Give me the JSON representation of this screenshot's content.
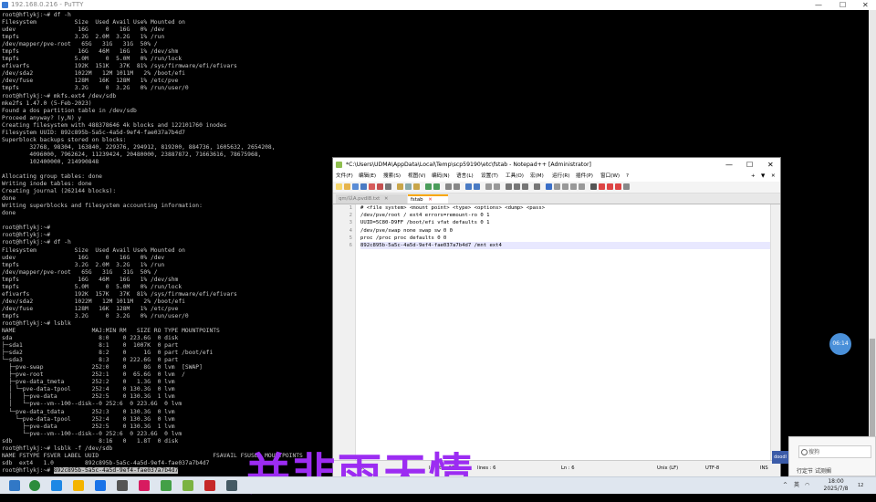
{
  "putty": {
    "title": "192.168.0.216 - PuTTY",
    "controls": {
      "minimize": "—",
      "maximize": "☐",
      "close": "✕"
    },
    "terminal_lines": [
      "root@hflykj:~# df -h",
      "Filesystem           Size  Used Avail Use% Mounted on",
      "udev                  16G     0   16G   0% /dev",
      "tmpfs                3.2G  2.0M  3.2G   1% /run",
      "/dev/mapper/pve-root   65G   31G   31G  50% /",
      "tmpfs                 16G   46M   16G   1% /dev/shm",
      "tmpfs                5.0M     0  5.0M   0% /run/lock",
      "efivarfs             192K  151K   37K  81% /sys/firmware/efi/efivars",
      "/dev/sda2            1022M   12M 1011M   2% /boot/efi",
      "/dev/fuse            128M   16K  128M   1% /etc/pve",
      "tmpfs                3.2G     0  3.2G   0% /run/user/0",
      "root@hflykj:~# mkfs.ext4 /dev/sdb",
      "mke2fs 1.47.0 (5-Feb-2023)",
      "Found a dos partition table in /dev/sdb",
      "Proceed anyway? (y,N) y",
      "Creating filesystem with 488378646 4k blocks and 122101760 inodes",
      "Filesystem UUID: 892c895b-5a5c-4a5d-9ef4-fae037a7b4d7",
      "Superblock backups stored on blocks:",
      "        32768, 98304, 163840, 229376, 294912, 819200, 884736, 1605632, 2654208,",
      "        4096000, 7962624, 11239424, 20480000, 23887872, 71663616, 78675968,",
      "        102400000, 214990848",
      "",
      "Allocating group tables: done",
      "Writing inode tables: done",
      "Creating journal (262144 blocks):",
      "done",
      "Writing superblocks and filesystem accounting information:",
      "done",
      "",
      "root@hflykj:~#",
      "root@hflykj:~#",
      "root@hflykj:~# df -h",
      "Filesystem           Size  Used Avail Use% Mounted on",
      "udev                  16G     0   16G   0% /dev",
      "tmpfs                3.2G  2.0M  3.2G   1% /run",
      "/dev/mapper/pve-root   65G   31G   31G  50% /",
      "tmpfs                 16G   46M   16G   1% /dev/shm",
      "tmpfs                5.0M     0  5.0M   0% /run/lock",
      "efivarfs             192K  157K   37K  81% /sys/firmware/efi/efivars",
      "/dev/sda2            1022M   12M 1011M   2% /boot/efi",
      "/dev/fuse            128M   16K  128M   1% /etc/pve",
      "tmpfs                3.2G     0  3.2G   0% /run/user/0",
      "root@hflykj:~# lsblk",
      "NAME                      MAJ:MIN RM   SIZE RO TYPE MOUNTPOINTS",
      "sda                         8:0    0 223.6G  0 disk",
      "├─sda1                      8:1    0  1007K  0 part",
      "├─sda2                      8:2    0     1G  0 part /boot/efi",
      "└─sda3                      8:3    0 222.6G  0 part",
      "  ├─pve-swap              252:0    0     8G  0 lvm  [SWAP]",
      "  ├─pve-root              252:1    0  65.6G  0 lvm  /",
      "  ├─pve-data_tmeta        252:2    0   1.3G  0 lvm",
      "  │ └─pve-data-tpool      252:4    0 130.3G  0 lvm",
      "  │   ├─pve-data          252:5    0 130.3G  1 lvm",
      "  │   └─pve--vm--100--disk--0 252:6  0 223.6G  0 lvm",
      "  └─pve-data_tdata        252:3    0 130.3G  0 lvm",
      "    └─pve-data-tpool      252:4    0 130.3G  0 lvm",
      "      ├─pve-data          252:5    0 130.3G  1 lvm",
      "      └─pve--vm--100--disk--0 252:6  0 223.6G  0 lvm",
      "sdb                         8:16   0   1.8T  0 disk",
      "root@hflykj:~# lsblk -f /dev/sdb",
      "NAME FSTYPE FSVER LABEL UUID                                 FSAVAIL FSUSE% MOUNTPOINTS",
      "sdb  ext4   1.0         892c895b-5a5c-4a5d-9ef4-fae037a7b4d7"
    ],
    "last_line_prefix": "root@hflykj:~# ",
    "last_line_selected": "892c895b-5a5c-4a5d-9ef4-fae037a7b4d7"
  },
  "notepad": {
    "title": "*C:\\Users\\UDMA\\AppData\\Local\\Temp\\scp59190\\etc\\fstab - Notepad++ [Administrator]",
    "controls": {
      "minimize": "—",
      "maximize": "☐",
      "close": "✕"
    },
    "menu": [
      "文件(F)",
      "编辑(E)",
      "搜索(S)",
      "视图(V)",
      "编码(N)",
      "语言(L)",
      "设置(T)",
      "工具(O)",
      "宏(M)",
      "运行(R)",
      "插件(P)",
      "窗口(W)",
      "?"
    ],
    "menu_right": [
      "+",
      "▼",
      "✕"
    ],
    "tabs": [
      {
        "label": "qm/以A.pvdl8.txt",
        "close": "✕"
      },
      {
        "label": "fstab",
        "close": "✕"
      }
    ],
    "line_numbers": [
      "1",
      "2",
      "3",
      "4",
      "5",
      "6"
    ],
    "lines": [
      "# <file system> <mount point> <type> <options> <dump> <pass>",
      "/dev/pve/root / ext4 errors=remount-ro 0 1",
      "UUID=5C80-D9FF /boot/efi vfat defaults 0 1",
      "/dev/pve/swap none swap sw 0 0",
      "proc /proc proc defaults 0 0",
      "892c895b-5a5c-4a5d-9ef4-fae037a7b4d7 /mnt ext4"
    ],
    "status": {
      "type": "ext",
      "length": "length : 234",
      "lines": "lines : 6",
      "ln": "Ln : 6",
      "eol": "Unix (LF)",
      "encoding": "UTF-8",
      "mode": "INS"
    }
  },
  "bubble_label": "06:14",
  "overlay_text": "并非雨天情",
  "popup": {
    "search_placeholder": "搜狗",
    "text": "行定节 试测搁"
  },
  "sideimg_label": "doodl",
  "tray": {
    "lang": "英",
    "clock_time": "18:00",
    "clock_date": "2025/7/8",
    "notification_count": "12"
  },
  "colors": {
    "overlay": "#9c2cf2",
    "terminal_text": "#c8c8c8",
    "bubble": "#4a90d9"
  }
}
